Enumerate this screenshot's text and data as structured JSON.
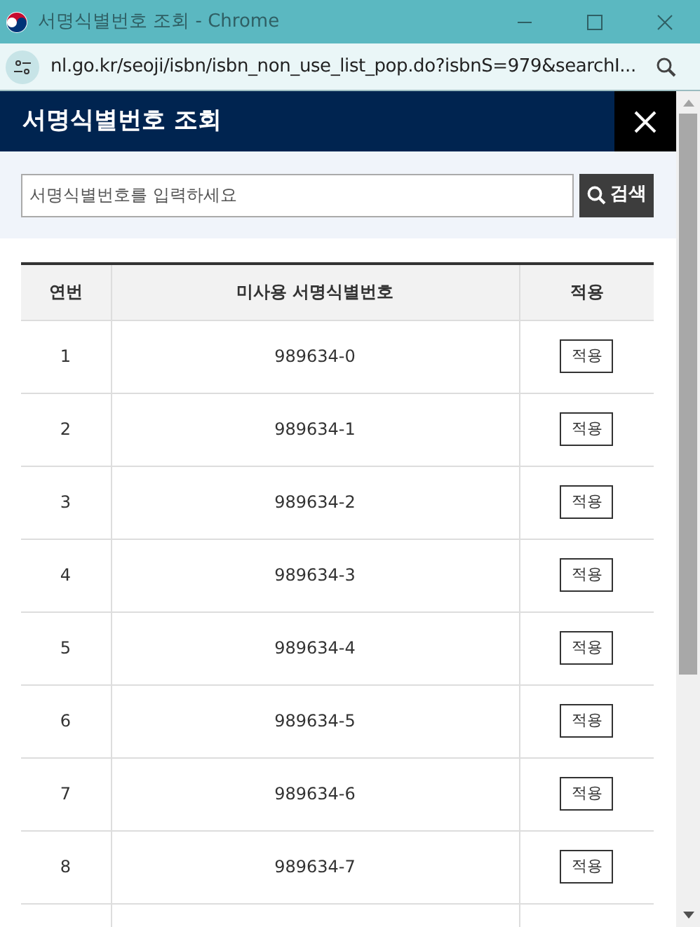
{
  "window": {
    "title": "서명식별번호 조회 - Chrome"
  },
  "address_bar": {
    "url": "nl.go.kr/seoji/isbn/isbn_non_use_list_pop.do?isbnS=979&searchI..."
  },
  "header": {
    "title": "서명식별번호 조회"
  },
  "search": {
    "placeholder": "서명식별번호를 입력하세요",
    "button": "검색"
  },
  "table": {
    "columns": [
      "연번",
      "미사용 서명식별번호",
      "적용"
    ],
    "rows": [
      {
        "no": "1",
        "number": "989634-0",
        "action": "적용"
      },
      {
        "no": "2",
        "number": "989634-1",
        "action": "적용"
      },
      {
        "no": "3",
        "number": "989634-2",
        "action": "적용"
      },
      {
        "no": "4",
        "number": "989634-3",
        "action": "적용"
      },
      {
        "no": "5",
        "number": "989634-4",
        "action": "적용"
      },
      {
        "no": "6",
        "number": "989634-5",
        "action": "적용"
      },
      {
        "no": "7",
        "number": "989634-6",
        "action": "적용"
      },
      {
        "no": "8",
        "number": "989634-7",
        "action": "적용"
      }
    ]
  }
}
